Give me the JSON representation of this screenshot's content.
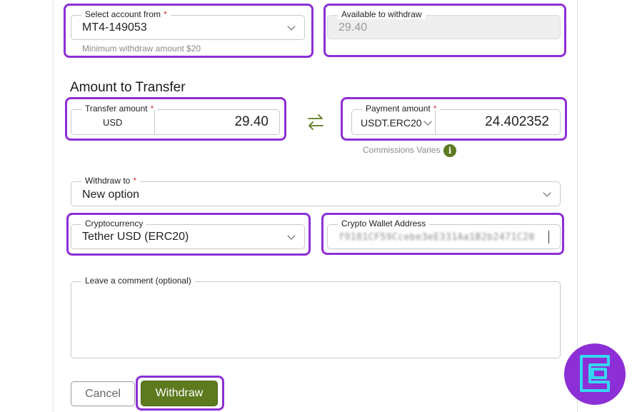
{
  "account_from": {
    "label": "Select account from",
    "required_mark": "*",
    "value": "MT4-149053",
    "hint": "Minimum withdraw amount $20"
  },
  "available": {
    "label": "Available to withdraw",
    "value": "29.40"
  },
  "section_title": "Amount to Transfer",
  "transfer_amount": {
    "label": "Transfer amount",
    "required_mark": "*",
    "currency": "USD",
    "value": "29.40"
  },
  "payment_amount": {
    "label": "Payment amount",
    "required_mark": "*",
    "currency": "USDT.ERC20",
    "value": "24.402352",
    "commission_note": "Commissions Varies",
    "info_glyph": "i"
  },
  "withdraw_to": {
    "label": "Withdraw to",
    "required_mark": "*",
    "value": "New option"
  },
  "cryptocurrency": {
    "label": "Cryptocurrency",
    "value": "Tether USD (ERC20)"
  },
  "wallet_address": {
    "label": "Crypto Wallet Address",
    "value": "f9181CF59Ccebe3eE331Aa1B2b2471C20"
  },
  "comment": {
    "label": "Leave a comment (optional)",
    "value": ""
  },
  "buttons": {
    "cancel": "Cancel",
    "withdraw": "Withdraw"
  },
  "icons": {
    "swap": "swap-arrows-icon",
    "chevron": "chevron-down-icon",
    "info": "info-icon",
    "logo": "brand-logo-icon"
  },
  "colors": {
    "highlight": "#8c2fd6",
    "accent_green": "#5d7a1f",
    "required": "#d0312d",
    "logo_cyan": "#35d7f0"
  }
}
